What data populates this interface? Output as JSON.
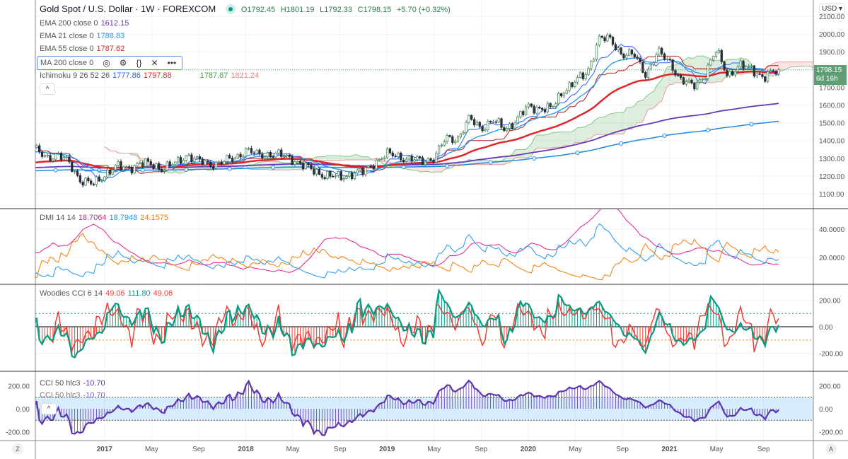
{
  "header": {
    "symbol": "Gold Spot / U.S. Dollar · 1W · FOREXCOM",
    "open": "O1792.45",
    "high": "H1801.19",
    "low": "L1792.33",
    "close": "C1798.15",
    "change": "+5.70 (+0.32%)"
  },
  "legends": {
    "ema200": {
      "label": "EMA 200 close 0",
      "value": "1612.15"
    },
    "ema21": {
      "label": "EMA 21 close 0",
      "value": "1788.83"
    },
    "ema55": {
      "label": "EMA 55 close 0",
      "value": "1787.62"
    },
    "ma200": {
      "label": "MA 200 close 0"
    },
    "ichimoku": {
      "label": "Ichimoku 9 26 52 26",
      "v1": "1777.86",
      "v2": "1797.88",
      "v3": "1787.87",
      "v4": "1821.24"
    },
    "dmi": {
      "label": "DMI 14 14",
      "v1": "18.7064",
      "v2": "18.7948",
      "v3": "24.1575"
    },
    "woodies": {
      "label": "Woodies CCI 6 14",
      "v1": "49.06",
      "v2": "111.80",
      "v3": "49.06"
    },
    "cci50": {
      "label": "CCI 50 hlc3",
      "value": "-10.70"
    }
  },
  "toolbar": {
    "currency": "USD ▾",
    "collapse": "^",
    "eye": "◎",
    "gear": "⚙",
    "braces": "{}",
    "close": "✕",
    "more": "•••",
    "left_scale": "Z",
    "right_scale": "A"
  },
  "price_tag": {
    "price": "1798.15",
    "countdown": "6d 16h"
  },
  "colors": {
    "up": "#3b7f4d",
    "down": "#2a2e39",
    "ema21": "#2196f3",
    "ema55": "#e0262c",
    "ema200": "#673ab7",
    "ma200": "#1e88e5",
    "adx": "#e91e8c",
    "plusdi": "#2196f3",
    "minusdi": "#f57c00",
    "cci6": "#f23b32",
    "cci14": "#089981",
    "cci50": "#5e35b1"
  },
  "chart_data": {
    "type": "candlestick",
    "interval": "1W",
    "start_month": "2016-07",
    "monthly_close": [
      1350,
      1310,
      1315,
      1275,
      1173,
      1150,
      1210,
      1250,
      1248,
      1268,
      1268,
      1241,
      1269,
      1321,
      1280,
      1270,
      1275,
      1302,
      1345,
      1318,
      1325,
      1315,
      1298,
      1252,
      1224,
      1200,
      1192,
      1215,
      1222,
      1282,
      1321,
      1313,
      1292,
      1283,
      1305,
      1409,
      1413,
      1520,
      1472,
      1512,
      1464,
      1517,
      1589,
      1585,
      1577,
      1686,
      1730,
      1781,
      1975,
      1967,
      1886,
      1879,
      1776,
      1895,
      1848,
      1734,
      1708,
      1769,
      1906,
      1770,
      1814,
      1814,
      1743,
      1798.15
    ],
    "seeds": {
      "ema200": 1245,
      "ma200": 1228,
      "ema55": 1270,
      "ema21": 1330
    },
    "price_axis": [
      "2100.00",
      "2000.00",
      "1900.00",
      "1800.00",
      "1700.00",
      "1600.00",
      "1500.00",
      "1400.00",
      "1300.00",
      "1200.00",
      "1100.00"
    ],
    "dmi_axis": [
      "40.0000",
      "20.0000"
    ],
    "woodies_axis": [
      "200.00",
      "0.00",
      "-200.00"
    ],
    "cci50_axis": [
      "200.00",
      "0.00",
      "-200.00"
    ],
    "time_axis": [
      "2017",
      "May",
      "Sep",
      "2018",
      "May",
      "Sep",
      "2019",
      "May",
      "Sep",
      "2020",
      "May",
      "Sep",
      "2021",
      "May",
      "Sep"
    ]
  }
}
